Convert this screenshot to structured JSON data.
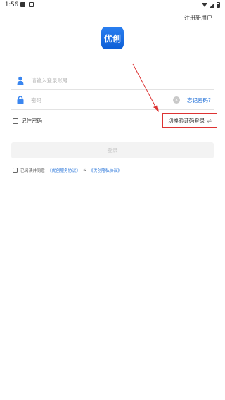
{
  "status_bar": {
    "time": "1:56"
  },
  "header": {
    "register_link": "注册新用户"
  },
  "logo": {
    "text": "优创"
  },
  "login_form": {
    "username_placeholder": "请输入登录账号",
    "password_placeholder": "密码",
    "clear_symbol": "×",
    "forgot_password": "忘记密码?",
    "remember_label": "记住密码",
    "switch_login_label": "切换验证码登录",
    "switch_icon": "⇌",
    "login_button": "登录"
  },
  "agreement": {
    "prefix": "已阅读并同意",
    "service_link": "《优创服务协议》",
    "amp": "&",
    "privacy_link": "《优创隐私协议》"
  },
  "colors": {
    "accent": "#1f6fd8",
    "annotation": "#dd3333"
  }
}
